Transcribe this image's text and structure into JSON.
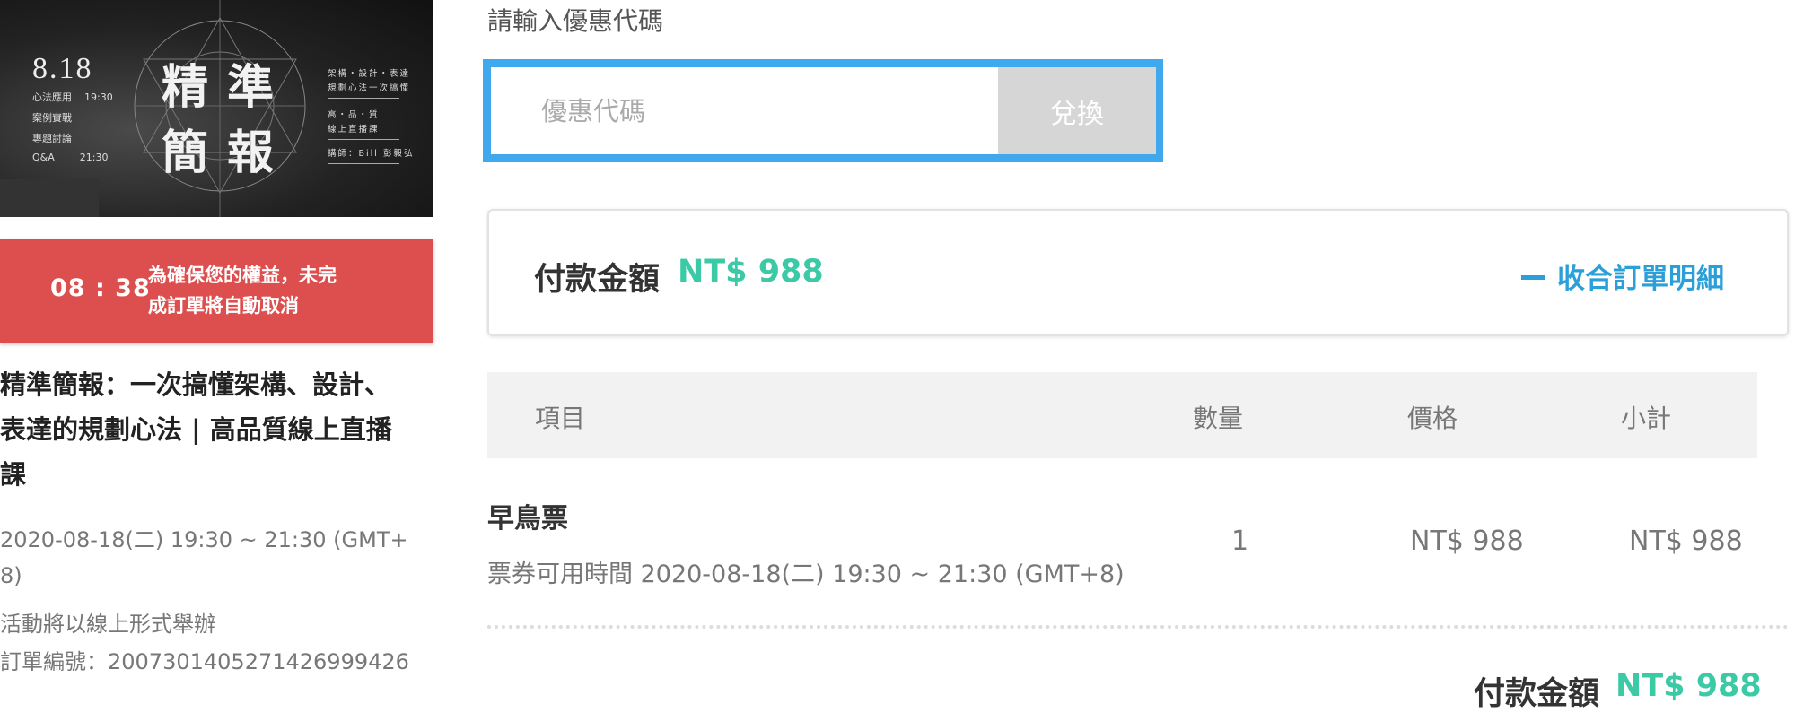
{
  "banner": {
    "date": "8.18",
    "agenda": [
      {
        "item": "心法應用",
        "time": "19:30"
      },
      {
        "item": "案例實戰",
        "time": ""
      },
      {
        "item": "專題討論",
        "time": ""
      },
      {
        "item": "Q&A",
        "time": "21:30"
      }
    ],
    "title_chars": [
      "精",
      "準",
      "簡",
      "報"
    ],
    "side_lines": [
      "架構・設計・表達",
      "規劃心法一次搞懂",
      "高・品・質",
      "線上直播課",
      "講師：Bill 彭毅弘"
    ]
  },
  "timer": {
    "value": "08 : 38",
    "note_line1": "為確保您的權益，未完",
    "note_line2": "成訂單將自動取消"
  },
  "event": {
    "title_line1": "精準簡報：一次搞懂架構、設計、",
    "title_line2": "表達的規劃心法 | 高品質線上直播",
    "title_line3": "課",
    "datetime_line1": "2020-08-18(二) 19:30 ~ 21:30 (GMT+",
    "datetime_line2": "8)",
    "format": "活動將以線上形式舉辦",
    "order_number": "訂單編號：2007301405271426999426"
  },
  "coupon": {
    "label": "請輸入優惠代碼",
    "placeholder": "優惠代碼",
    "button": "兌換"
  },
  "summary": {
    "label": "付款金額",
    "amount": "NT$ 988",
    "collapse": "收合訂單明細"
  },
  "table": {
    "headers": [
      "項目",
      "數量",
      "價格",
      "小計"
    ],
    "rows": [
      {
        "name": "早鳥票",
        "note": "票券可用時間 2020-08-18(二) 19:30 ~ 21:30 (GMT+8)",
        "qty": "1",
        "price": "NT$ 988",
        "subtotal": "NT$ 988"
      }
    ]
  },
  "total": {
    "label": "付款金額",
    "amount": "NT$ 988"
  },
  "colors": {
    "timer_bg": "#dd4f4f",
    "accent_green": "#3cc9a6",
    "link_blue": "#2a9fd8",
    "focus_border": "#40a8ec"
  }
}
